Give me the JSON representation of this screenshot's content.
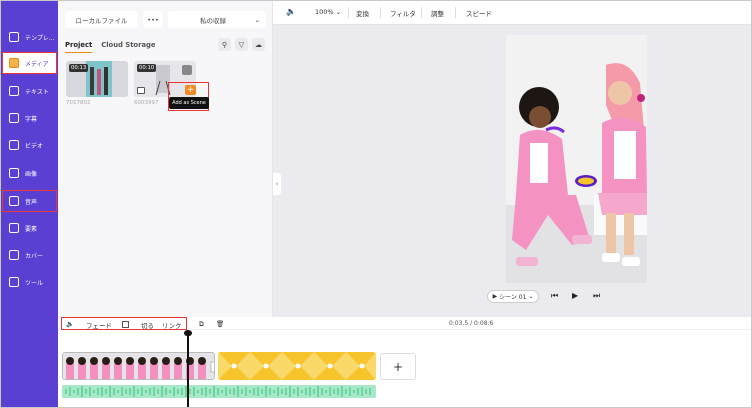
{
  "sidebar": {
    "items": [
      {
        "label": "テンプレ...",
        "icon": "template-icon"
      },
      {
        "label": "メディア",
        "icon": "folder-icon"
      },
      {
        "label": "テキスト",
        "icon": "text-icon"
      },
      {
        "label": "字幕",
        "icon": "subtitle-icon"
      },
      {
        "label": "ビデオ",
        "icon": "video-icon"
      },
      {
        "label": "画像",
        "icon": "image-icon"
      },
      {
        "label": "音声",
        "icon": "music-icon"
      },
      {
        "label": "要素",
        "icon": "elements-icon"
      },
      {
        "label": "カバー",
        "icon": "cover-icon"
      },
      {
        "label": "ツール",
        "icon": "tools-icon"
      }
    ]
  },
  "panel": {
    "local_file": "ローカルファイル",
    "more": "•••",
    "my_collection": "私の収録",
    "tab_project": "Project",
    "tab_cloud": "Cloud Storage",
    "media": [
      {
        "duration": "00:13",
        "id": "7017802"
      },
      {
        "duration": "00:10",
        "id": "6003997"
      }
    ],
    "tooltip": "Add as Scene"
  },
  "toolbar": {
    "zoom": "100%",
    "transform": "変換",
    "filter": "フィルタ",
    "adjust": "調整",
    "speed": "スピード"
  },
  "player": {
    "scene": "シーン 01"
  },
  "timeline_toolbar": {
    "fade": "フェード",
    "cut": "切る",
    "link": "リンク",
    "timecode": "0:03.5 / 0:08.6"
  },
  "colors": {
    "sidebar": "#5b3fd2",
    "accent": "#f08a24",
    "highlight": "#e33333",
    "yellow_clip": "#f7c52b",
    "audio_wave": "#2fbf7d"
  }
}
